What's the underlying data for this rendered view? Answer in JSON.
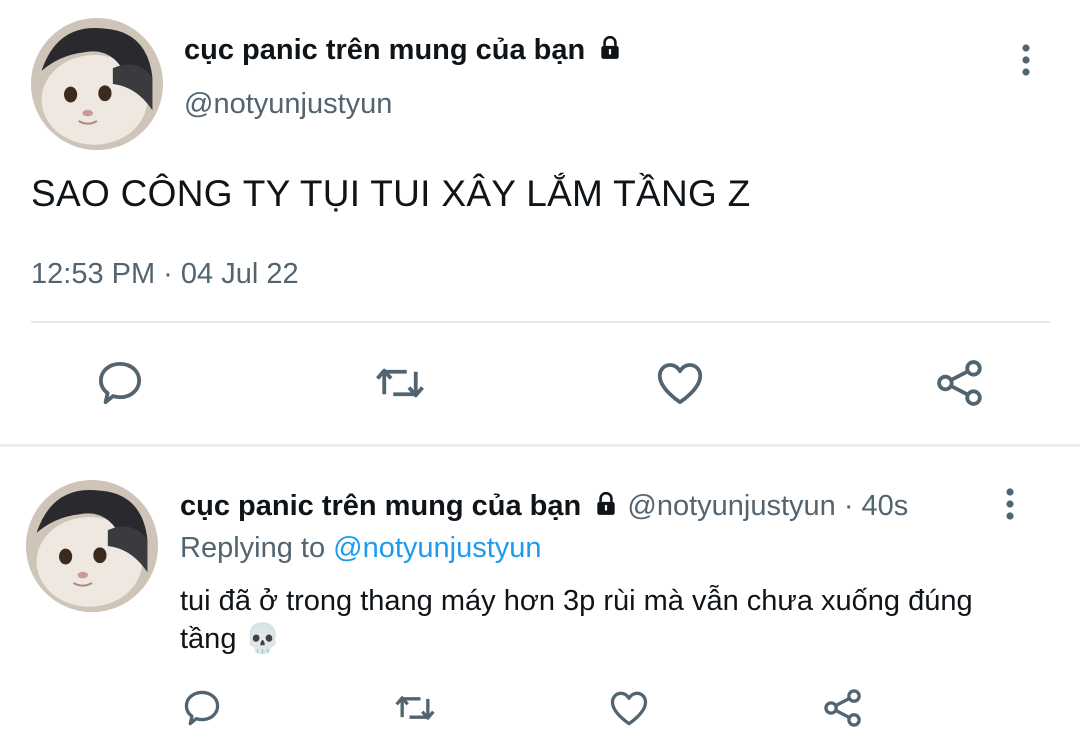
{
  "main_tweet": {
    "display_name": "cục panic trên mung của bạn",
    "handle": "@notyunjustyun",
    "text": "SAO CÔNG TY TỤI TUI XÂY LẮM TẦNG Z",
    "timestamp": "12:53 PM · 04 Jul 22"
  },
  "reply_tweet": {
    "display_name": "cục panic trên mung của bạn",
    "handle_time": "@notyunjustyun · 40s",
    "replying_prefix": "Replying to",
    "replying_mention": "@notyunjustyun",
    "text": "tui đã ở trong thang máy hơn 3p rùi mà vẫn chưa xuống đúng tầng 💀"
  },
  "icons": {
    "lock": "lock-icon",
    "more": "more-vertical-icon",
    "reply": "reply-icon",
    "retweet": "retweet-icon",
    "like": "like-icon",
    "share": "share-icon"
  },
  "colors": {
    "text_primary": "#0f1419",
    "text_secondary": "#536471",
    "mention": "#1d9bf0",
    "icon": "#536471"
  }
}
